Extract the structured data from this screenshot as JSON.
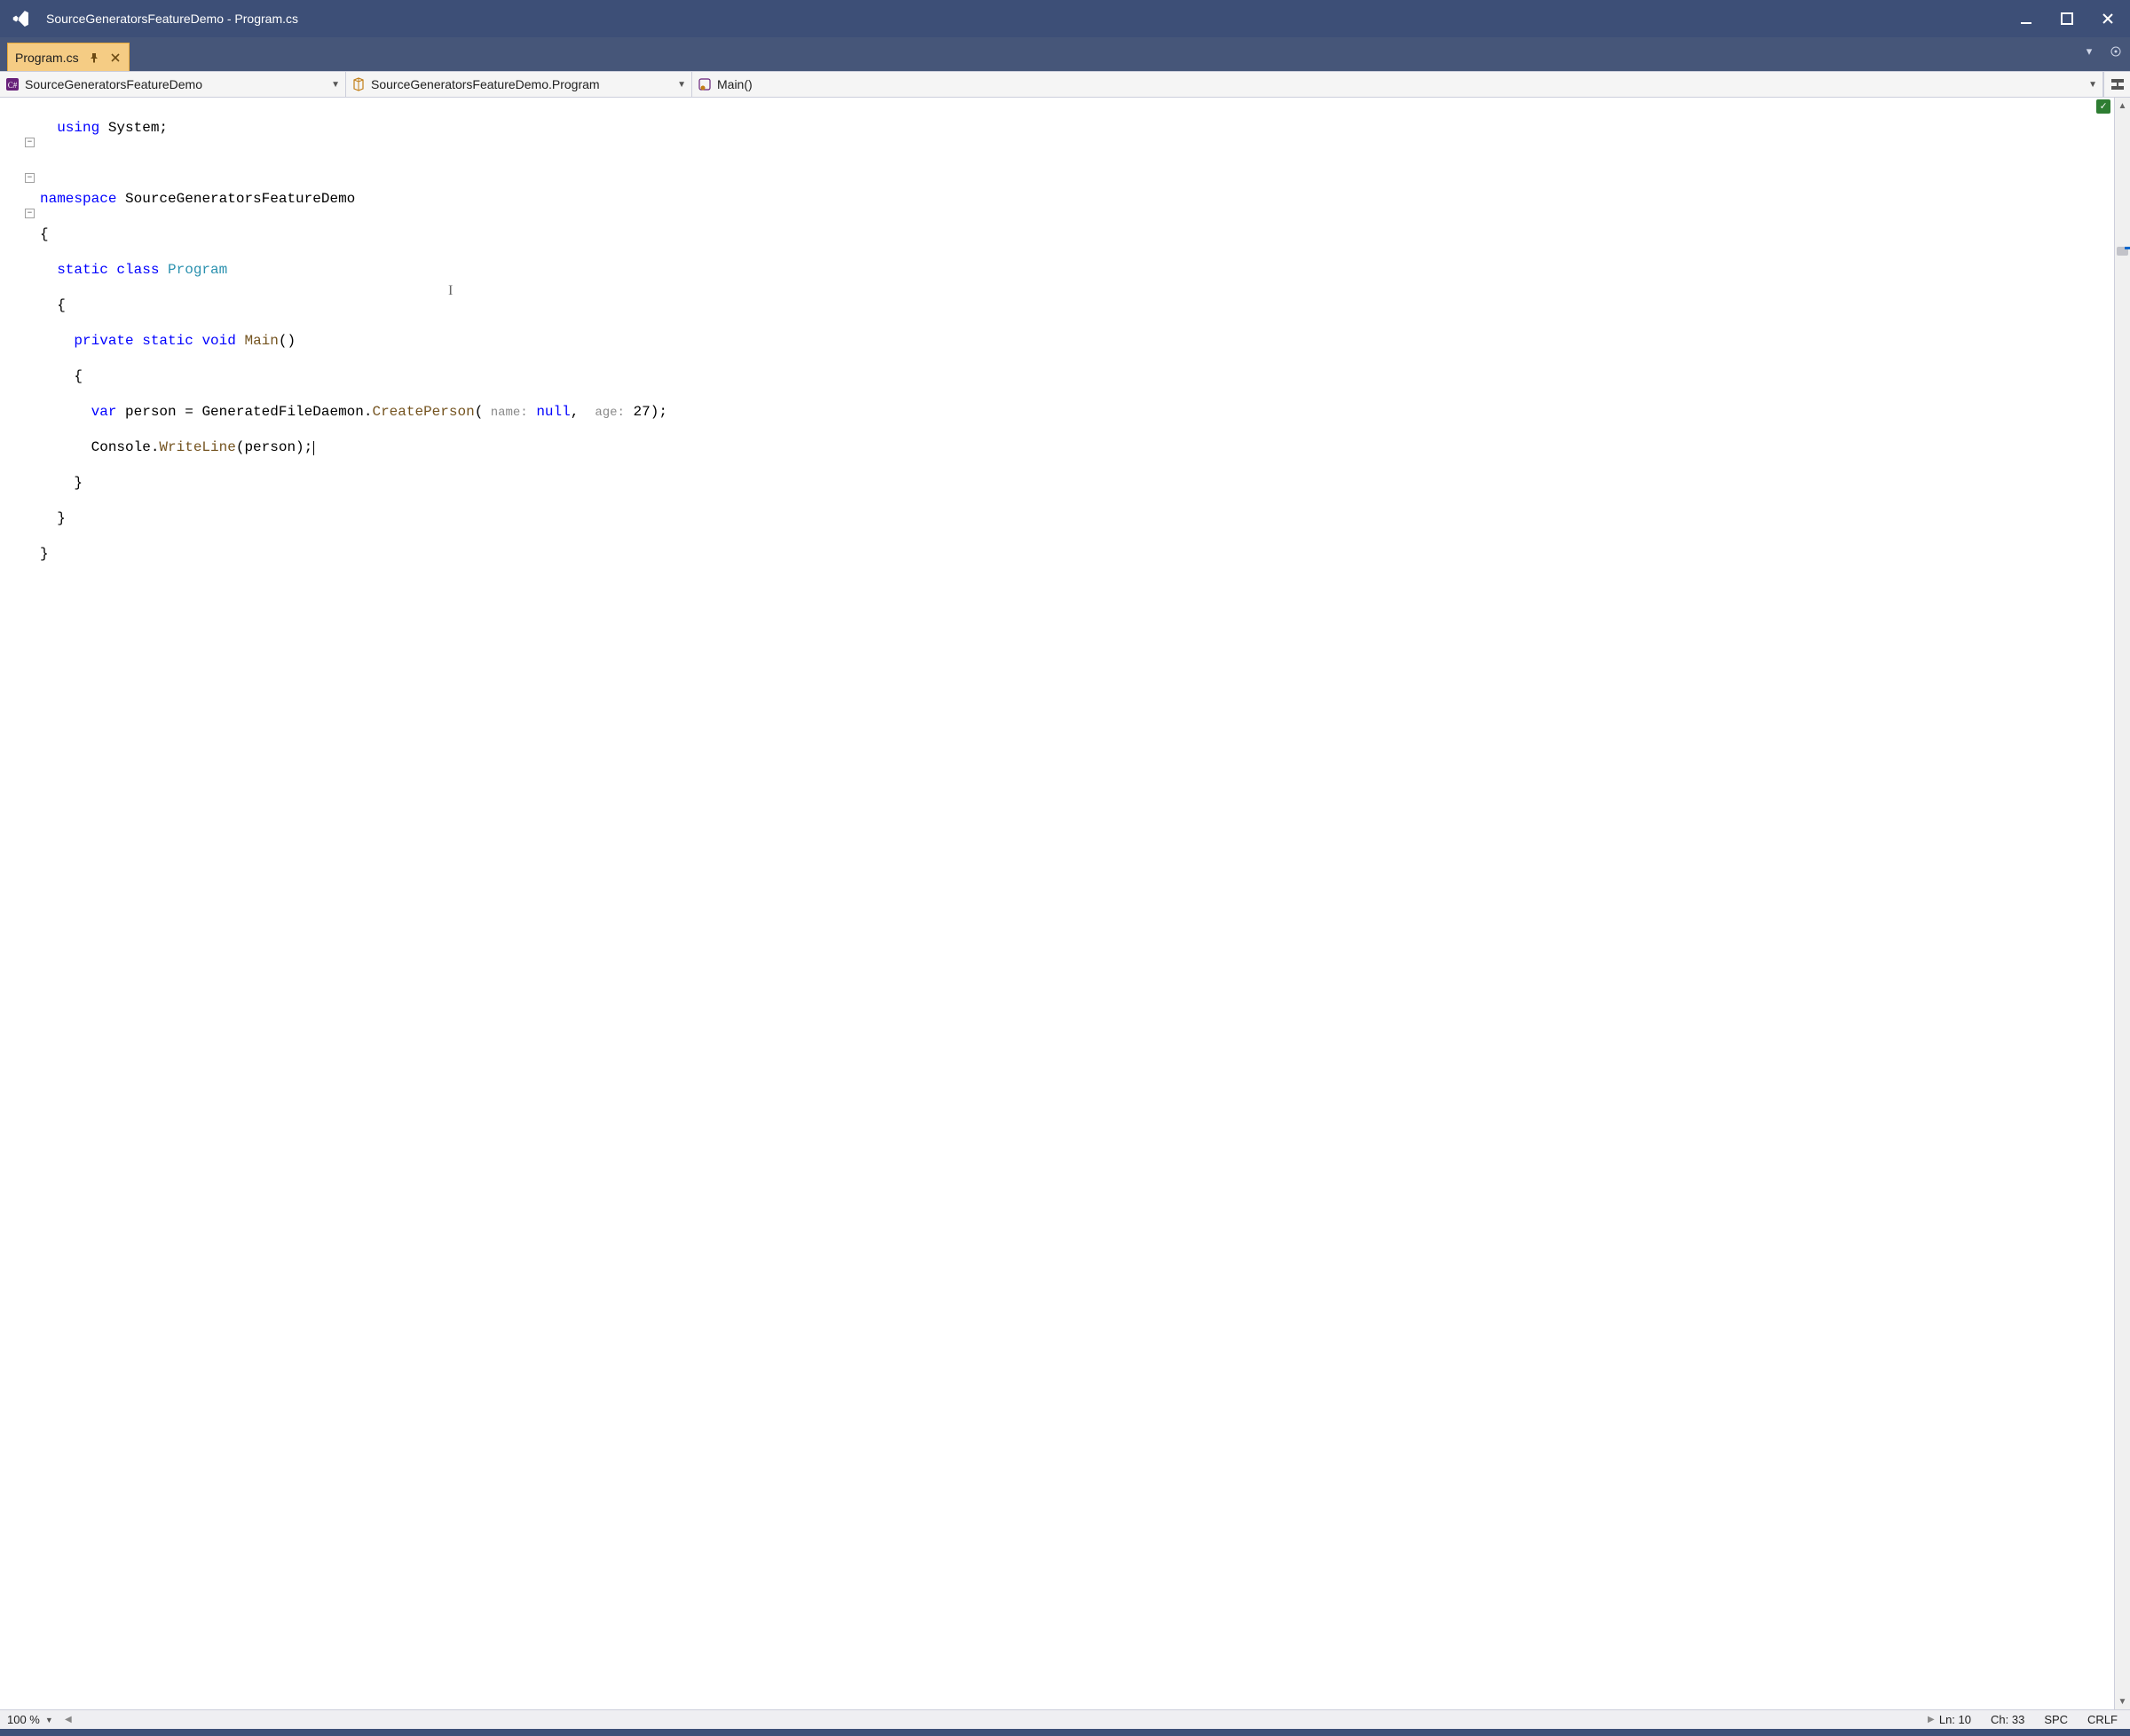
{
  "window": {
    "title": "SourceGeneratorsFeatureDemo - Program.cs"
  },
  "tab": {
    "label": "Program.cs"
  },
  "nav": {
    "project": "SourceGeneratorsFeatureDemo",
    "class": "SourceGeneratorsFeatureDemo.Program",
    "member": "Main()"
  },
  "code": {
    "l1_kw_using": "using",
    "l1_ns": " System;",
    "l3_kw_namespace": "namespace",
    "l3_ns": " SourceGeneratorsFeatureDemo",
    "l4_open": "{",
    "l5_kw_static": "static",
    "l5_kw_class": " class",
    "l5_typ": " Program",
    "l6_open": "  {",
    "l7_kw_private": "private",
    "l7_kw_static": " static",
    "l7_kw_void": " void",
    "l7_mth": " Main",
    "l7_paren": "()",
    "l8_open": "    {",
    "l9_kw_var": "var",
    "l9_a": " person = GeneratedFileDaemon.",
    "l9_mth": "CreatePerson",
    "l9_open": "(",
    "l9_hint1": " name:",
    "l9_null": " null",
    "l9_comma": ", ",
    "l9_hint2": " age:",
    "l9_b": " 27);",
    "l10_a": "      Console.",
    "l10_mth": "WriteLine",
    "l10_b": "(person);",
    "l11_close": "    }",
    "l12_close": "  }",
    "l13_close": "}"
  },
  "status": {
    "zoom": "100 %",
    "line": "Ln: 10",
    "char": "Ch: 33",
    "indent": "SPC",
    "eol": "CRLF"
  }
}
